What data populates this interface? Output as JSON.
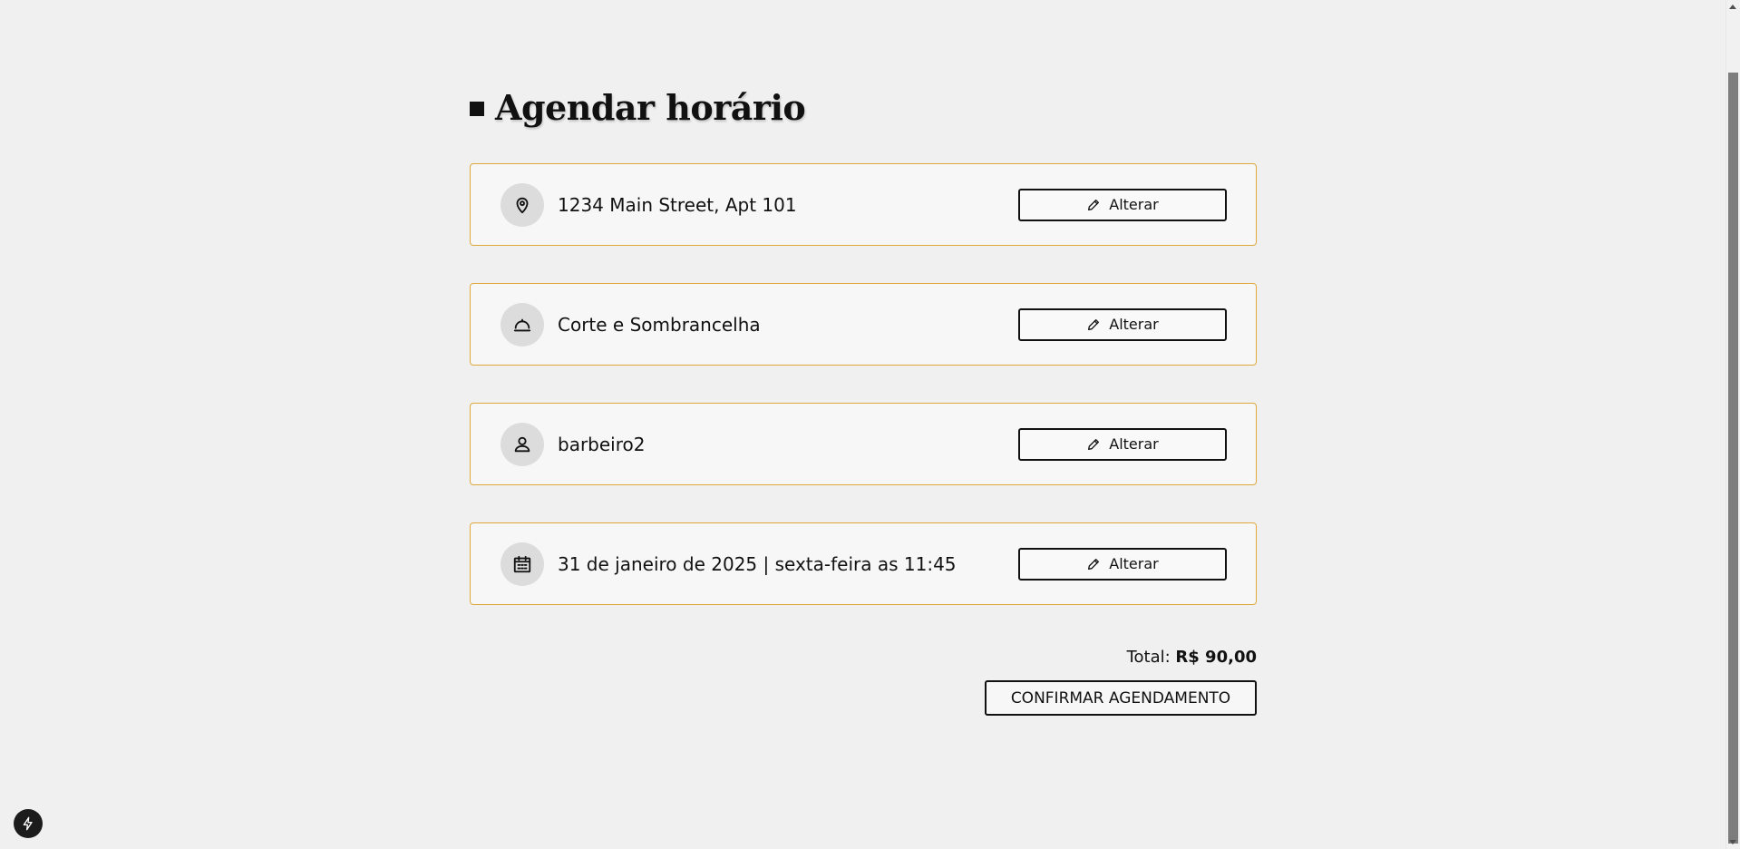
{
  "page": {
    "title": "Agendar horário"
  },
  "cards": [
    {
      "icon": "location-pin-icon",
      "text": "1234 Main Street, Apt 101",
      "button_label": "Alterar"
    },
    {
      "icon": "service-cloche-icon",
      "text": "Corte e Sombrancelha",
      "button_label": "Alterar"
    },
    {
      "icon": "user-icon",
      "text": "barbeiro2",
      "button_label": "Alterar"
    },
    {
      "icon": "calendar-icon",
      "text": "31 de janeiro de 2025 | sexta-feira as 11:45",
      "button_label": "Alterar"
    }
  ],
  "summary": {
    "total_label": "Total:",
    "total_value": "R$ 90,00",
    "confirm_label": "CONFIRMAR AGENDAMENTO"
  },
  "colors": {
    "card_border": "#e0a83a",
    "background": "#f0f0f0",
    "icon_circle": "#dcdcdc"
  },
  "dev_badge": {
    "icon": "lightning-icon"
  }
}
